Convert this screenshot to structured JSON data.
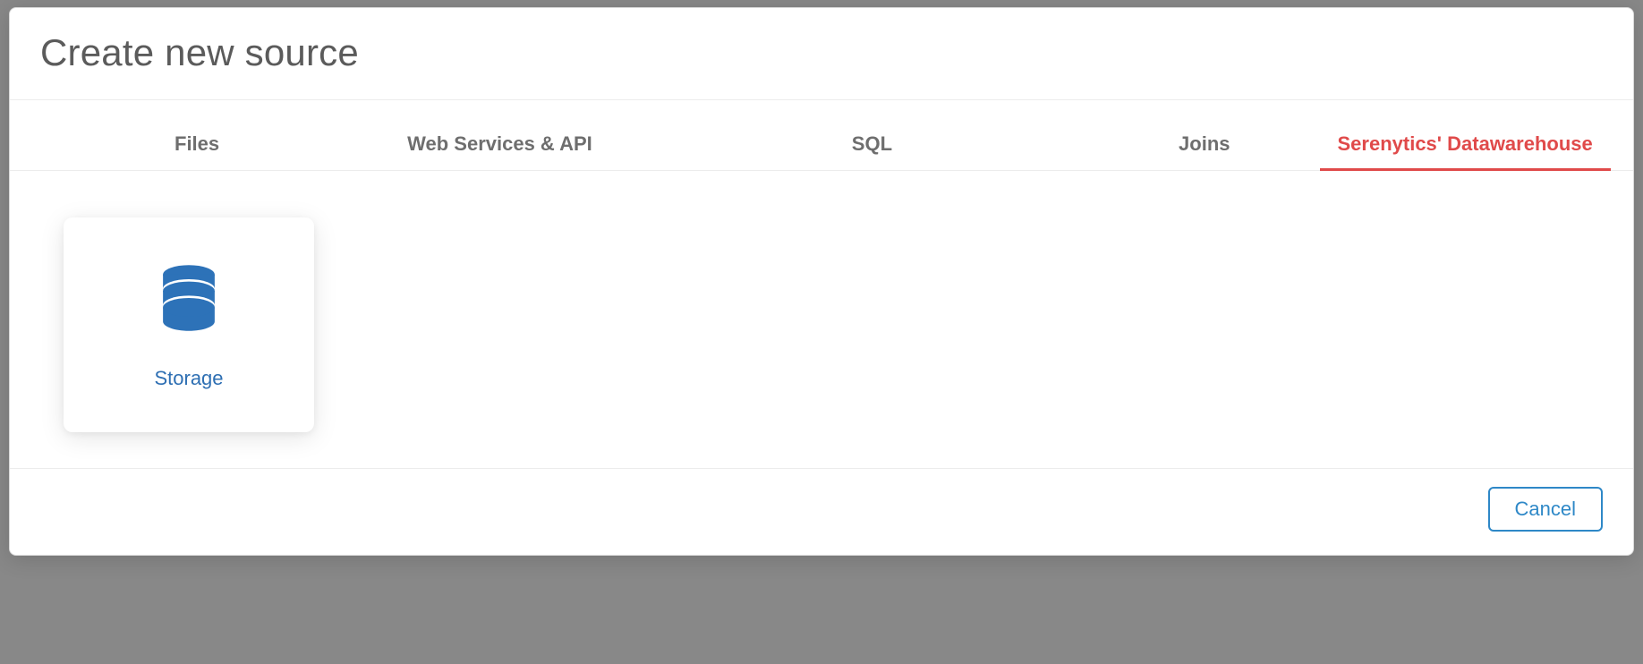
{
  "modal": {
    "title": "Create new source",
    "tabs": [
      {
        "label": "Files",
        "active": false
      },
      {
        "label": "Web Services & API",
        "active": false
      },
      {
        "label": "SQL",
        "active": false
      },
      {
        "label": "Joins",
        "active": false
      },
      {
        "label": "Serenytics' Datawarehouse",
        "active": true
      }
    ],
    "cards": [
      {
        "label": "Storage",
        "icon": "database-icon"
      }
    ],
    "footer": {
      "cancel_label": "Cancel"
    }
  },
  "colors": {
    "accent_red": "#e04a4a",
    "accent_blue": "#2e6fb3",
    "button_blue": "#2e88c7",
    "icon_blue": "#2d72b8"
  }
}
